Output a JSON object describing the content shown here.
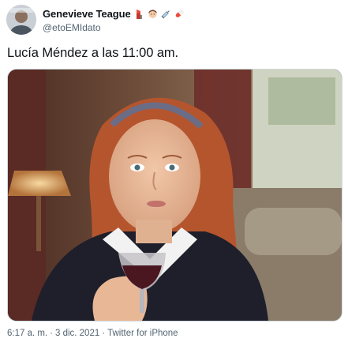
{
  "user": {
    "display_name": "Genevieve Teague",
    "handle": "@etoEMIdato",
    "avatar_icon": "avatar-photo",
    "name_emojis": [
      "lipstick-icon",
      "woman-face-icon",
      "syringe-icon",
      "pill-icon"
    ]
  },
  "tweet": {
    "text": "Lucía Méndez a las 11:00 am."
  },
  "media": {
    "kind": "photo",
    "description_icon": "girl-with-wine-glass-photo"
  },
  "meta": {
    "time": "6:17 a. m.",
    "date": "3 dic. 2021",
    "source": "Twitter for iPhone",
    "separator": "·"
  },
  "colors": {
    "text": "#0f1419",
    "secondary": "#536471",
    "border": "#cfd9de"
  }
}
